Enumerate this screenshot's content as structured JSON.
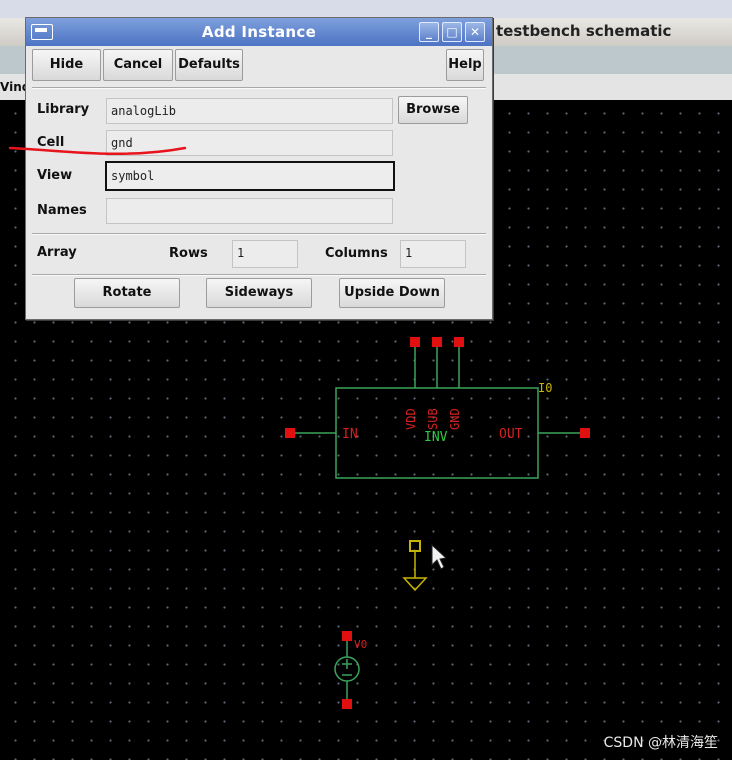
{
  "background_window": {
    "title": "testbench schematic",
    "menu_fragment": "Vind"
  },
  "dialog": {
    "title": "Add Instance",
    "window_controls": [
      "_",
      "□",
      "✕"
    ],
    "buttons": {
      "hide": "Hide",
      "cancel": "Cancel",
      "defaults": "Defaults",
      "help": "Help",
      "browse": "Browse",
      "rotate": "Rotate",
      "sideways": "Sideways",
      "upside_down": "Upside Down"
    },
    "fields": {
      "library": {
        "label": "Library",
        "value": "analogLib"
      },
      "cell": {
        "label": "Cell",
        "value": "gnd"
      },
      "view": {
        "label": "View",
        "value": "symbol"
      },
      "names": {
        "label": "Names",
        "value": ""
      }
    },
    "array": {
      "label": "Array",
      "rows_label": "Rows",
      "rows_value": "1",
      "columns_label": "Columns",
      "columns_value": "1"
    }
  },
  "schematic": {
    "instance_name": "I0",
    "cell_label": "INV",
    "pins": {
      "in": "IN",
      "out": "OUT",
      "vdd": "VDD",
      "sub": "SUB",
      "gnd": "GND"
    },
    "source_name": "V0",
    "colors": {
      "wire": "#3aa35a",
      "pin": "#e01010",
      "text": "#d42020",
      "inst": "#c8b400",
      "cell": "#2ecc40",
      "gnd": "#c8b400"
    }
  },
  "watermark": "CSDN @林清海笙"
}
